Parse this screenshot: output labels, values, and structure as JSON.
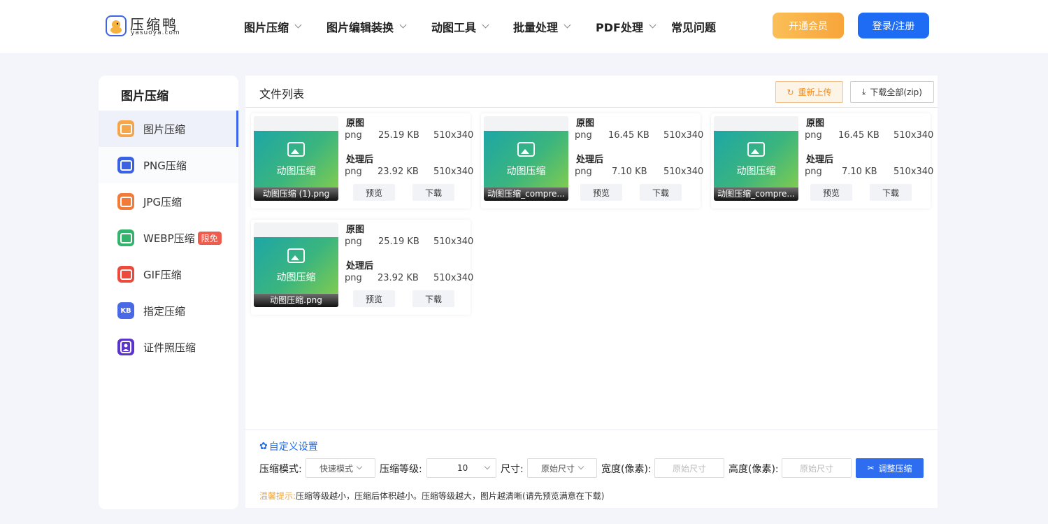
{
  "header": {
    "logo_text": "压缩鸭",
    "logo_sub": "yasuoya.com",
    "nav": [
      {
        "label": "图片压缩",
        "dropdown": true
      },
      {
        "label": "图片编辑装换",
        "dropdown": true
      },
      {
        "label": "动图工具",
        "dropdown": true
      },
      {
        "label": "批量处理",
        "dropdown": true
      },
      {
        "label": "PDF处理",
        "dropdown": true
      },
      {
        "label": "常见问题",
        "dropdown": false
      }
    ],
    "vip_button": "开通会员",
    "login_button": "登录/注册"
  },
  "sidebar": {
    "title": "图片压缩",
    "items": [
      {
        "label": "图片压缩",
        "icon": "image-icon",
        "color": "#f5a54a",
        "active": true
      },
      {
        "label": "PNG压缩",
        "icon": "png-icon",
        "color": "#3a62e2",
        "active": false
      },
      {
        "label": "JPG压缩",
        "icon": "jpg-icon",
        "color": "#f27b3a",
        "active": false
      },
      {
        "label": "WEBP压缩",
        "icon": "webp-icon",
        "color": "#33b36b",
        "active": false,
        "badge": "限免"
      },
      {
        "label": "GIF压缩",
        "icon": "gif-icon",
        "color": "#ea4b3d",
        "active": false
      },
      {
        "label": "指定压缩",
        "icon": "kb-icon",
        "color": "#4a69e6",
        "active": false,
        "icon_text": "KB"
      },
      {
        "label": "证件照压缩",
        "icon": "id-photo-icon",
        "color": "#5b34c9",
        "active": false
      }
    ]
  },
  "main": {
    "title": "文件列表",
    "reupload_button": "重新上传",
    "download_all_button": "下载全部(zip)",
    "thumb_caption": "动图压缩",
    "labels": {
      "original": "原图",
      "processed": "处理后",
      "preview": "预览",
      "download": "下载"
    },
    "files": [
      {
        "name": "动图压缩 (1).png",
        "orig": {
          "fmt": "png",
          "size": "25.19 KB",
          "dim": "510x340"
        },
        "proc": {
          "fmt": "png",
          "size": "23.92 KB",
          "dim": "510x340"
        }
      },
      {
        "name": "动图压缩_compre...",
        "orig": {
          "fmt": "png",
          "size": "16.45 KB",
          "dim": "510x340"
        },
        "proc": {
          "fmt": "png",
          "size": "7.10 KB",
          "dim": "510x340"
        }
      },
      {
        "name": "动图压缩_compre...",
        "orig": {
          "fmt": "png",
          "size": "16.45 KB",
          "dim": "510x340"
        },
        "proc": {
          "fmt": "png",
          "size": "7.10 KB",
          "dim": "510x340"
        }
      },
      {
        "name": "动图压缩.png",
        "orig": {
          "fmt": "png",
          "size": "25.19 KB",
          "dim": "510x340"
        },
        "proc": {
          "fmt": "png",
          "size": "23.92 KB",
          "dim": "510x340"
        }
      }
    ]
  },
  "settings": {
    "title": "自定义设置",
    "mode_label": "压缩模式:",
    "mode_value": "快速模式",
    "level_label": "压缩等级:",
    "level_value": "10",
    "size_label": "尺寸:",
    "size_value": "原始尺寸",
    "width_label": "宽度(像素):",
    "width_placeholder": "原始尺寸",
    "height_label": "高度(像素):",
    "height_placeholder": "原始尺寸",
    "adjust_button": "调整压缩",
    "tip_prefix": "温馨提示:",
    "tip_text": "压缩等级越小，压缩后体积越小。压缩等级越大，图片越清晰(请先预览满意在下载)"
  }
}
